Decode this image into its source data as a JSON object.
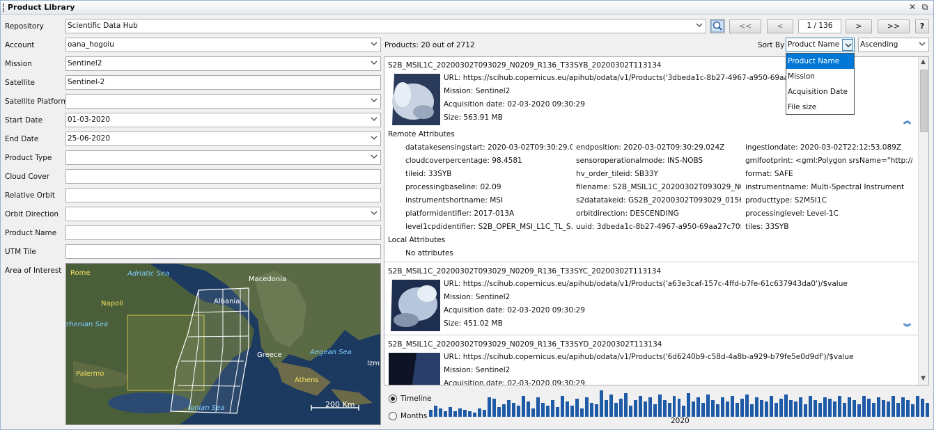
{
  "window": {
    "title": "Product Library"
  },
  "colors": {
    "accent": "#0078d7",
    "timeline_bar": "#1f5aa6",
    "link_blue": "#1a5fb4"
  },
  "filters": {
    "repository": {
      "label": "Repository",
      "value": "Scientific Data Hub"
    },
    "account": {
      "label": "Account",
      "value": "oana_hogoiu"
    },
    "mission": {
      "label": "Mission",
      "value": "Sentinel2"
    },
    "satellite": {
      "label": "Satellite",
      "value": "Sentinel-2"
    },
    "satellite_platform": {
      "label": "Satellite Platform",
      "value": ""
    },
    "start_date": {
      "label": "Start Date",
      "value": "01-03-2020"
    },
    "end_date": {
      "label": "End Date",
      "value": "25-06-2020"
    },
    "product_type": {
      "label": "Product Type",
      "value": ""
    },
    "cloud_cover": {
      "label": "Cloud Cover",
      "value": ""
    },
    "relative_orbit": {
      "label": "Relative Orbit",
      "value": ""
    },
    "orbit_direction": {
      "label": "Orbit Direction",
      "value": ""
    },
    "product_name": {
      "label": "Product Name",
      "value": ""
    },
    "utm_tile": {
      "label": "UTM Tile",
      "value": ""
    },
    "area_of_interest": {
      "label": "Area of Interest"
    }
  },
  "map": {
    "labels": [
      "Rome",
      "Adriatic Sea",
      "Macedonia",
      "Napoli",
      "Albania",
      "rrhenian Sea",
      "Greece",
      "Aegean Sea",
      "Palermo",
      "Athens",
      "Izmi",
      "Ionian Sea"
    ],
    "scale": "200 Km"
  },
  "paging": {
    "first": "<<",
    "prev": "<",
    "page": "1 / 136",
    "next": ">",
    "last": ">>",
    "help": "?"
  },
  "toolbar": {
    "products_count": "Products: 20 out of 2712",
    "sort_by_label": "Sort By",
    "sort_by_value": "Product Name",
    "order_value": "Ascending",
    "sort_options": [
      "Product Name",
      "Mission",
      "Acquisition Date",
      "File size"
    ]
  },
  "products": [
    {
      "name": "S2B_MSIL1C_20200302T093029_N0209_R136_T33SYB_20200302T113134",
      "url": "URL: https://scihub.copernicus.eu/apihub/odata/v1/Products('3dbeda1c-8b27-4967-a950-69aa27c70f73')/$value",
      "mission": "Mission: Sentinel2",
      "acquisition": "Acquisition date: 02-03-2020 09:30:29",
      "size": "Size: 563.91 MB",
      "remote_title": "Remote Attributes",
      "local_title": "Local Attributes",
      "local_value": "No attributes",
      "attributes": [
        [
          "datatakesensingstart: 2020-03-02T09:30:29.0...",
          "endposition: 2020-03-02T09:30:29.024Z",
          "ingestiondate: 2020-03-02T22:12:53.089Z"
        ],
        [
          "cloudcoverpercentage: 98.4581",
          "sensoroperationalmode: INS-NOBS",
          "gmlfootprint: <gml:Polygon srsName=\"http://w..."
        ],
        [
          "tileid: 33SYB",
          "hv_order_tileid: SB33Y",
          "format: SAFE"
        ],
        [
          "processingbaseline: 02.09",
          "filename: S2B_MSIL1C_20200302T093029_N0...",
          "instrumentname: Multi-Spectral Instrument"
        ],
        [
          "instrumentshortname: MSI",
          "s2datatakeid: GS2B_20200302T093029_01560...",
          "producttype: S2MSI1C"
        ],
        [
          "platformidentifier: 2017-013A",
          "orbitdirection: DESCENDING",
          "processinglevel: Level-1C"
        ],
        [
          "level1cpdidentifier: S2B_OPER_MSI_L1C_TL_S...",
          "uuid: 3dbeda1c-8b27-4967-a950-69aa27c70f73",
          "tiles: 33SYB"
        ]
      ]
    },
    {
      "name": "S2B_MSIL1C_20200302T093029_N0209_R136_T33SYC_20200302T113134",
      "url": "URL: https://scihub.copernicus.eu/apihub/odata/v1/Products('a63e3caf-157c-4ffd-b7fe-61c637943da0')/$value",
      "mission": "Mission: Sentinel2",
      "acquisition": "Acquisition date: 02-03-2020 09:30:29",
      "size": "Size: 451.02 MB"
    },
    {
      "name": "S2B_MSIL1C_20200302T093029_N0209_R136_T33SYD_20200302T113134",
      "url": "URL: https://scihub.copernicus.eu/apihub/odata/v1/Products('6d6240b9-c58d-4a8b-a929-b79fe5e0d9df')/$value",
      "mission": "Mission: Sentinel2",
      "acquisition": "Acquisition date: 02-03-2020 09:30:29"
    }
  ],
  "timeline": {
    "timeline_label": "Timeline",
    "months_label": "Months",
    "year": "2020",
    "selected": "timeline",
    "bar_levels": [
      0.25,
      0.4,
      0.3,
      0.2,
      0.35,
      0.2,
      0.3,
      0.25,
      0.2,
      0.15,
      0.3,
      0.25,
      0.7,
      0.65,
      0.35,
      0.45,
      0.6,
      0.5,
      0.4,
      0.75,
      0.55,
      0.3,
      0.7,
      0.5,
      0.4,
      0.6,
      0.35,
      0.75,
      0.55,
      0.4,
      0.65,
      0.3,
      0.7,
      0.5,
      0.45,
      0.95,
      0.6,
      0.8,
      0.5,
      0.65,
      0.85,
      0.4,
      0.6,
      0.75,
      0.55,
      0.7,
      0.45,
      0.8,
      0.6,
      0.5,
      0.75,
      0.65,
      0.4,
      0.85,
      0.55,
      0.7,
      0.5,
      0.8,
      0.6,
      0.45,
      0.7,
      0.55,
      0.75,
      0.5,
      0.65,
      0.8,
      0.45,
      0.7,
      0.6,
      0.55,
      0.75,
      0.5,
      0.65,
      0.8,
      0.6,
      0.55,
      0.7,
      0.45,
      0.75,
      0.6,
      0.5,
      0.7,
      0.65,
      0.55,
      0.75,
      0.5,
      0.7,
      0.6,
      0.45,
      0.75,
      0.65,
      0.5,
      0.7,
      0.6,
      0.55,
      0.75,
      0.5,
      0.7,
      0.6,
      0.45,
      0.75,
      0.65,
      0.5
    ]
  }
}
